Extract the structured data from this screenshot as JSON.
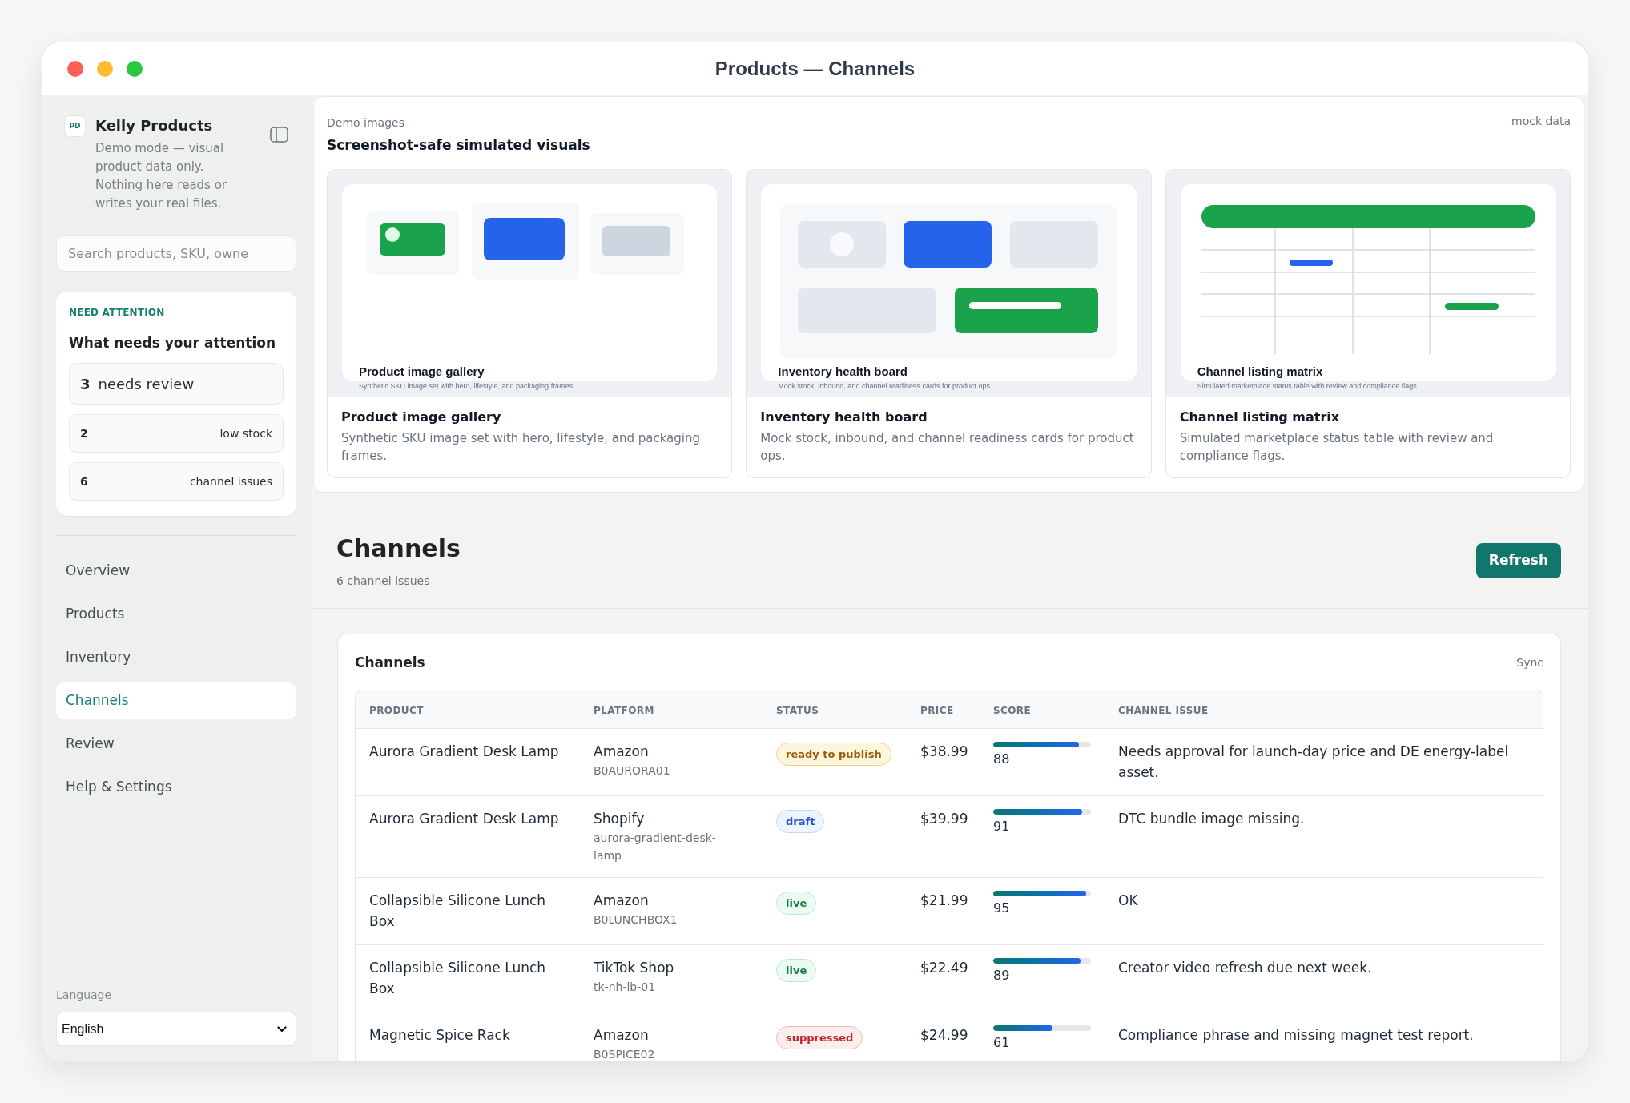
{
  "window": {
    "title": "Products — Channels"
  },
  "sidebar": {
    "brand": {
      "logo": "PD",
      "name": "Kelly Products",
      "description": "Demo mode — visual product data only. Nothing here reads or writes your real files."
    },
    "search": {
      "placeholder": "Search products, SKU, owne"
    },
    "attention": {
      "eyebrow": "NEED ATTENTION",
      "title": "What needs your attention",
      "items": [
        {
          "kind": "featured",
          "count": "3",
          "label": "needs review"
        },
        {
          "kind": "compact",
          "count": "2",
          "label": "low stock"
        },
        {
          "kind": "compact",
          "count": "6",
          "label": "channel issues"
        }
      ]
    },
    "nav": [
      {
        "label": "Overview",
        "selected": false
      },
      {
        "label": "Products",
        "selected": false
      },
      {
        "label": "Inventory",
        "selected": false
      },
      {
        "label": "Channels",
        "selected": true
      },
      {
        "label": "Review",
        "selected": false
      },
      {
        "label": "Help & Settings",
        "selected": false
      }
    ],
    "language": {
      "label": "Language",
      "value": "English"
    }
  },
  "demo_images": {
    "eyebrow": "Demo images",
    "title": "Screenshot-safe simulated visuals",
    "tag": "mock data",
    "cards": [
      {
        "kind": "gallery",
        "preview_title": "Product image gallery",
        "preview_caption": "Synthetic SKU image set with hero, lifestyle, and packaging frames.",
        "title": "Product image gallery",
        "description": "Synthetic SKU image set with hero, lifestyle, and packaging frames."
      },
      {
        "kind": "inventory",
        "preview_title": "Inventory health board",
        "preview_caption": "Mock stock, inbound, and channel readiness cards for product ops.",
        "title": "Inventory health board",
        "description": "Mock stock, inbound, and channel readiness cards for product ops."
      },
      {
        "kind": "matrix",
        "preview_title": "Channel listing matrix",
        "preview_caption": "Simulated marketplace status table with review and compliance flags.",
        "title": "Channel listing matrix",
        "description": "Simulated marketplace status table with review and compliance flags."
      }
    ]
  },
  "page_header": {
    "title": "Channels",
    "subtitle": "6 channel issues",
    "button": "Refresh"
  },
  "channels_table": {
    "title": "Channels",
    "action": "Sync",
    "columns": [
      "PRODUCT",
      "PLATFORM",
      "STATUS",
      "PRICE",
      "SCORE",
      "CHANNEL ISSUE"
    ],
    "rows": [
      {
        "product": "Aurora Gradient Desk Lamp",
        "platform": "Amazon",
        "listing_id": "B0AURORA01",
        "status": {
          "label": "ready to publish",
          "kind": "warning"
        },
        "price": "$38.99",
        "score": {
          "level": 0.88,
          "reading": "88"
        },
        "issue": "Needs approval for launch-day price and DE energy-label asset."
      },
      {
        "product": "Aurora Gradient Desk Lamp",
        "platform": "Shopify",
        "listing_id": "aurora-gradient-desk-lamp",
        "status": {
          "label": "draft",
          "kind": "info"
        },
        "price": "$39.99",
        "score": {
          "level": 0.91,
          "reading": "91"
        },
        "issue": "DTC bundle image missing."
      },
      {
        "product": "Collapsible Silicone Lunch Box",
        "platform": "Amazon",
        "listing_id": "B0LUNCHBOX1",
        "status": {
          "label": "live",
          "kind": "success"
        },
        "price": "$21.99",
        "score": {
          "level": 0.95,
          "reading": "95"
        },
        "issue": "OK"
      },
      {
        "product": "Collapsible Silicone Lunch Box",
        "platform": "TikTok Shop",
        "listing_id": "tk-nh-lb-01",
        "status": {
          "label": "live",
          "kind": "success"
        },
        "price": "$22.49",
        "score": {
          "level": 0.89,
          "reading": "89"
        },
        "issue": "Creator video refresh due next week."
      },
      {
        "product": "Magnetic Spice Rack",
        "platform": "Amazon",
        "listing_id": "B0SPICE02",
        "status": {
          "label": "suppressed",
          "kind": "danger"
        },
        "price": "$24.99",
        "score": {
          "level": 0.61,
          "reading": "61"
        },
        "issue": "Compliance phrase and missing magnet test report."
      }
    ]
  }
}
